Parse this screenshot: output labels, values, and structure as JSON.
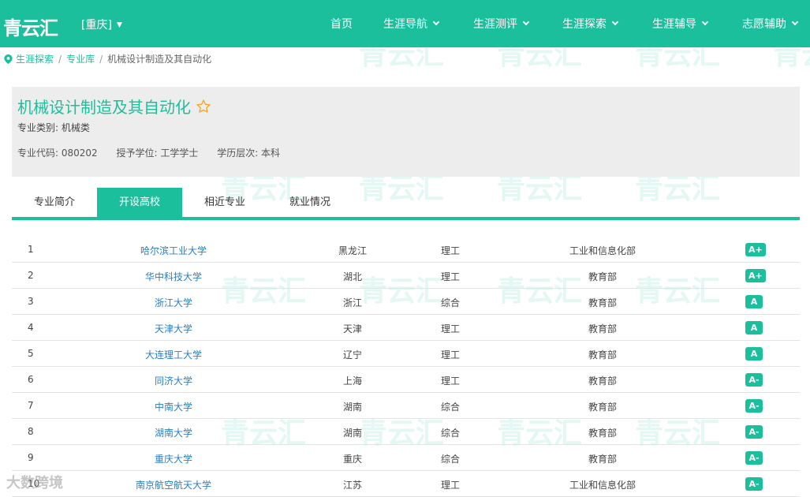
{
  "header": {
    "logo": "青云汇",
    "city": "[重庆]",
    "nav": [
      {
        "label": "首页",
        "dropdown": false
      },
      {
        "label": "生涯导航",
        "dropdown": true
      },
      {
        "label": "生涯测评",
        "dropdown": true
      },
      {
        "label": "生涯探索",
        "dropdown": true
      },
      {
        "label": "生涯辅导",
        "dropdown": true
      },
      {
        "label": "志愿辅助",
        "dropdown": true
      }
    ]
  },
  "breadcrumb": [
    "生涯探索",
    "专业库",
    "机械设计制造及其自动化"
  ],
  "major": {
    "title": "机械设计制造及其自动化",
    "category": "专业类别: 机械类",
    "code": "专业代码: 080202",
    "degree": "授予学位: 工学学士",
    "level": "学历层次: 本科"
  },
  "tabs": [
    "专业简介",
    "开设高校",
    "相近专业",
    "就业情况"
  ],
  "active_tab": 1,
  "schools": [
    {
      "idx": "1",
      "name": "哈尔滨工业大学",
      "province": "黑龙江",
      "type": "理工",
      "dept": "工业和信息化部",
      "grade": "A+"
    },
    {
      "idx": "2",
      "name": "华中科技大学",
      "province": "湖北",
      "type": "理工",
      "dept": "教育部",
      "grade": "A+"
    },
    {
      "idx": "3",
      "name": "浙江大学",
      "province": "浙江",
      "type": "综合",
      "dept": "教育部",
      "grade": "A"
    },
    {
      "idx": "4",
      "name": "天津大学",
      "province": "天津",
      "type": "理工",
      "dept": "教育部",
      "grade": "A"
    },
    {
      "idx": "5",
      "name": "大连理工大学",
      "province": "辽宁",
      "type": "理工",
      "dept": "教育部",
      "grade": "A"
    },
    {
      "idx": "6",
      "name": "同济大学",
      "province": "上海",
      "type": "理工",
      "dept": "教育部",
      "grade": "A-"
    },
    {
      "idx": "7",
      "name": "中南大学",
      "province": "湖南",
      "type": "综合",
      "dept": "教育部",
      "grade": "A-"
    },
    {
      "idx": "8",
      "name": "湖南大学",
      "province": "湖南",
      "type": "综合",
      "dept": "教育部",
      "grade": "A-"
    },
    {
      "idx": "9",
      "name": "重庆大学",
      "province": "重庆",
      "type": "综合",
      "dept": "教育部",
      "grade": "A-"
    },
    {
      "idx": "10",
      "name": "南京航空航天大学",
      "province": "江苏",
      "type": "理工",
      "dept": "工业和信息化部",
      "grade": "A-"
    }
  ],
  "watermark": "青云汇",
  "corner_watermark": "大数跨境",
  "colors": {
    "brand": "#1cbf9c",
    "link": "#2a7ec4"
  }
}
